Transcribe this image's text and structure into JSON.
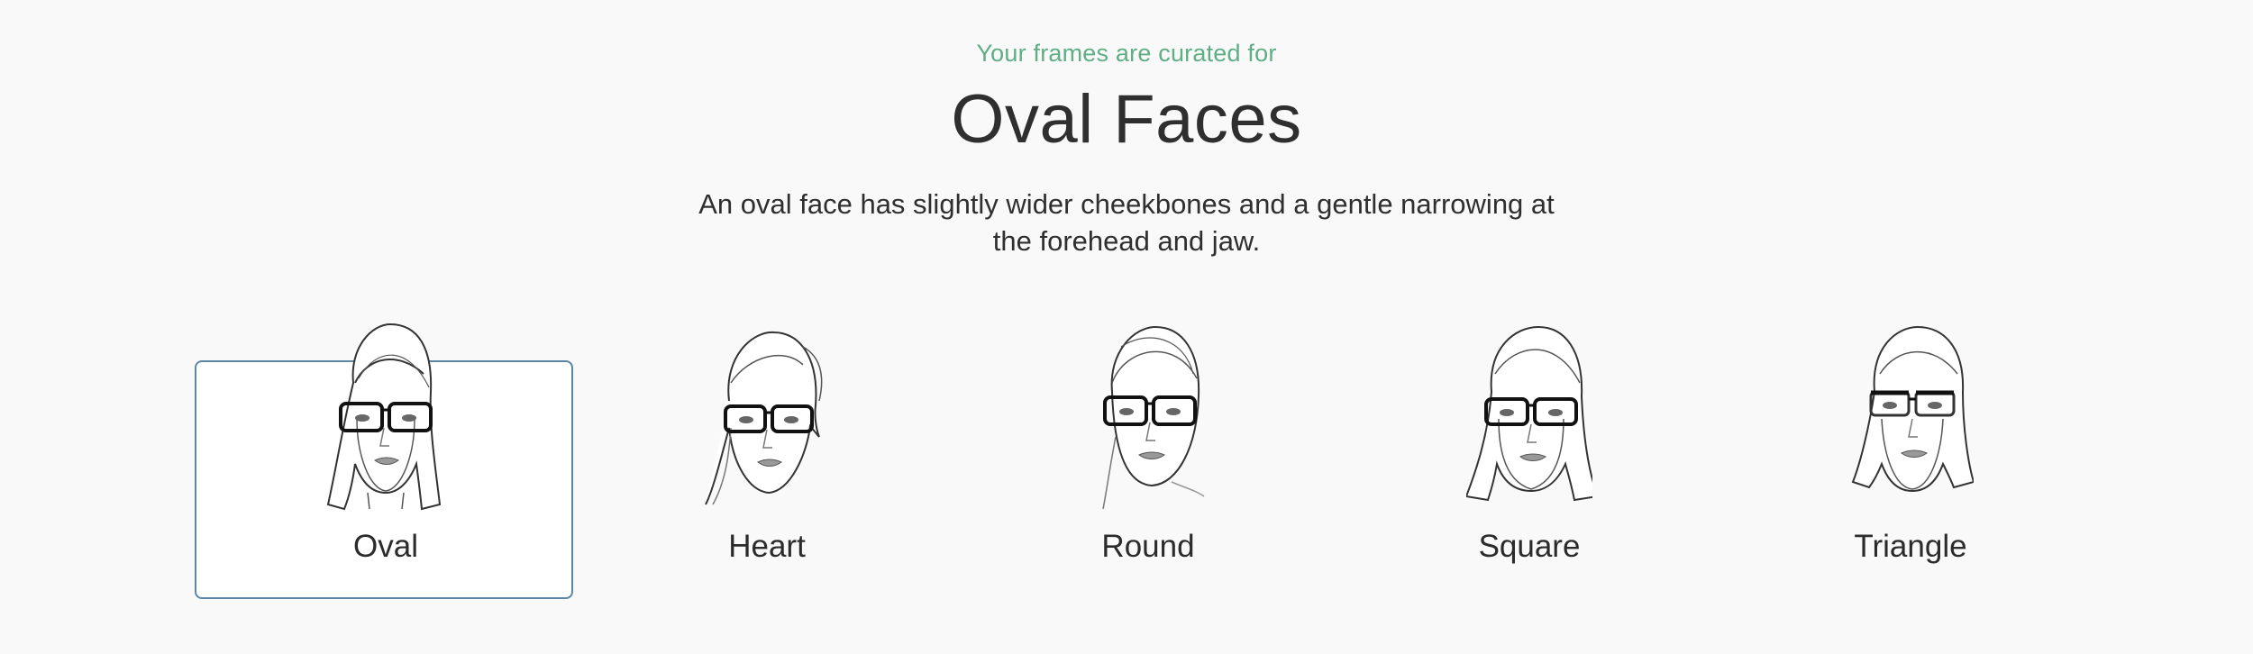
{
  "header": {
    "eyebrow": "Your frames are curated for",
    "title": "Oval Faces",
    "description": "An oval face has slightly wider cheekbones and a gentle narrowing at the forehead and jaw."
  },
  "face_shapes": [
    {
      "label": "Oval",
      "selected": true
    },
    {
      "label": "Heart",
      "selected": false
    },
    {
      "label": "Round",
      "selected": false
    },
    {
      "label": "Square",
      "selected": false
    },
    {
      "label": "Triangle",
      "selected": false
    }
  ],
  "colors": {
    "accent_green": "#5fae86",
    "selected_border": "#5b86a6",
    "background": "#f9f9f9"
  }
}
